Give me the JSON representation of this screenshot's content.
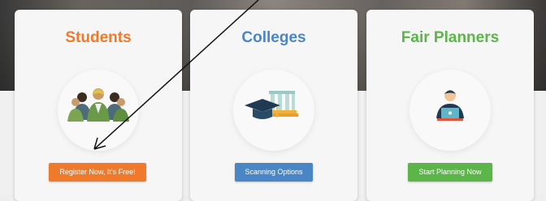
{
  "colors": {
    "students_accent": "#f07a2c",
    "colleges_accent": "#4a86c5",
    "planners_accent": "#5bb548"
  },
  "cards": [
    {
      "title": "Students",
      "icon": "students-group-icon",
      "button_label": "Register Now, It's Free!"
    },
    {
      "title": "Colleges",
      "icon": "graduation-cap-building-icon",
      "button_label": "Scanning Options"
    },
    {
      "title": "Fair Planners",
      "icon": "planner-laptop-icon",
      "button_label": "Start Planning Now"
    }
  ],
  "annotation": {
    "icon": "arrow-pointer-icon"
  }
}
